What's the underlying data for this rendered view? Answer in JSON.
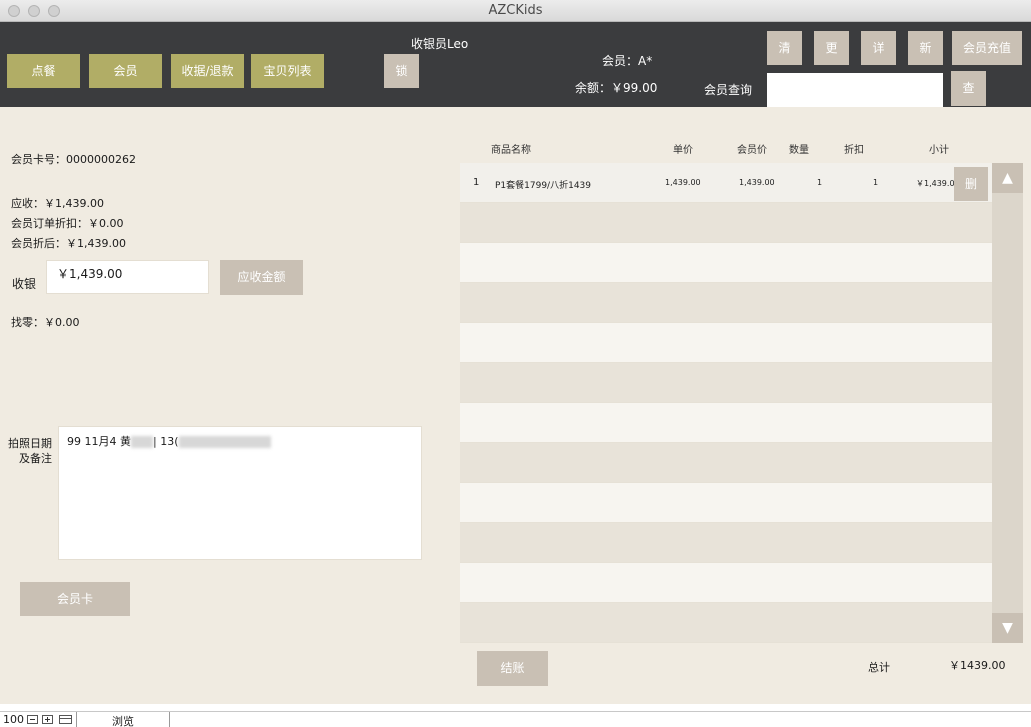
{
  "window": {
    "title": "AZCKids"
  },
  "toolbar": {
    "nav_buttons": [
      "点餐",
      "会员",
      "收据/退款",
      "宝贝列表"
    ],
    "cashier_label": "收银员Leo",
    "lock_label": "锁",
    "member_label": "会员：A*",
    "balance_label": "余额：￥99.00",
    "member_search_label": "会员查询",
    "member_search_value": "",
    "action_buttons": {
      "clear": "清",
      "change": "更",
      "detail": "详",
      "new": "新"
    },
    "recharge_label": "会员充值",
    "search_button": "查"
  },
  "left_panel": {
    "card_no": "会员卡号：0000000262",
    "receivable": "应收：￥1,439.00",
    "order_discount": "会员订单折扣：￥0.00",
    "after_discount": "会员折后：￥1,439.00",
    "cash_label": "收银",
    "cash_value": "￥1,439.00",
    "due_amount_button": "应收金额",
    "change_text": "找零：￥0.00",
    "notes_label_line1": "拍照日期",
    "notes_label_line2": "及备注",
    "notes_prefix": "99 11月4 黄",
    "notes_mid": "| 13(",
    "member_card_button": "会员卡"
  },
  "order_table": {
    "columns": [
      "商品名称",
      "单价",
      "会员价",
      "数量",
      "折扣",
      "小计"
    ],
    "rows": [
      {
        "index": "1",
        "name": "P1套餐1799/八折1439",
        "price": "1,439.00",
        "member_price": "1,439.00",
        "qty": "1",
        "discount": "1",
        "subtotal": "￥1,439.00",
        "delete_label": "删"
      }
    ],
    "scroll_up": "▲",
    "scroll_down": "▼"
  },
  "footer": {
    "checkout_label": "结账",
    "total_label": "总计",
    "total_value": "￥1439.00"
  },
  "statusbar": {
    "zoom": "100",
    "mode": "浏览"
  }
}
